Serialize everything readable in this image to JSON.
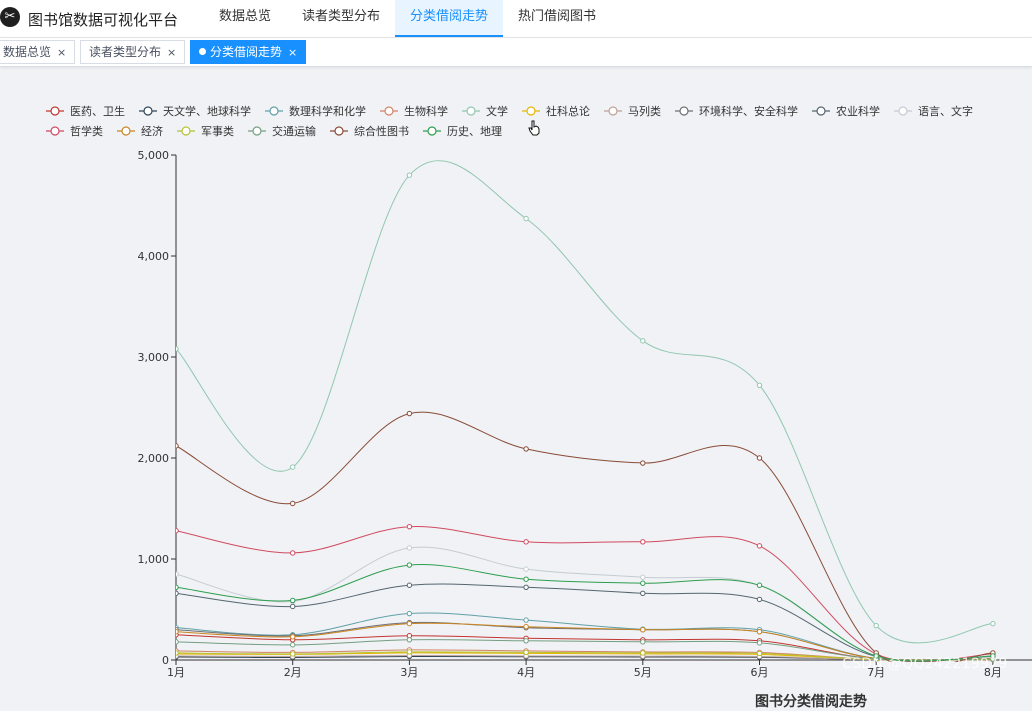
{
  "app": {
    "title": "图书馆数据可视化平台",
    "logo_icon": "scissors-logo-icon"
  },
  "nav": [
    {
      "label": "数据总览",
      "active": false
    },
    {
      "label": "读者类型分布",
      "active": false
    },
    {
      "label": "分类借阅走势",
      "active": true
    },
    {
      "label": "热门借阅图书",
      "active": false
    }
  ],
  "tags": [
    {
      "label": "数据总览",
      "active": false
    },
    {
      "label": "读者类型分布",
      "active": false
    },
    {
      "label": "分类借阅走势",
      "active": true
    }
  ],
  "tag_close_symbol": "×",
  "watermark": "CSDN @QQ242219979",
  "chart_data": {
    "type": "line",
    "title": "图书分类借阅走势",
    "x": [
      "1月",
      "2月",
      "3月",
      "4月",
      "5月",
      "6月",
      "7月",
      "8月"
    ],
    "ylim": [
      0,
      5000
    ],
    "yticks": [
      "0",
      "1,000",
      "2,000",
      "3,000",
      "4,000",
      "5,000"
    ],
    "grid": false,
    "smooth": true,
    "legend_position": "top",
    "series": [
      {
        "name": "医药、卫生",
        "color": "#c23531",
        "values": [
          250,
          200,
          240,
          215,
          200,
          190,
          10,
          10
        ]
      },
      {
        "name": "天文学、地球科学",
        "color": "#2f4554",
        "values": [
          30,
          25,
          35,
          32,
          30,
          28,
          5,
          5
        ]
      },
      {
        "name": "数理科学和化学",
        "color": "#61a0a8",
        "values": [
          320,
          250,
          460,
          395,
          305,
          300,
          15,
          15
        ]
      },
      {
        "name": "生物科学",
        "color": "#d48265",
        "values": [
          90,
          75,
          100,
          90,
          80,
          75,
          5,
          5
        ]
      },
      {
        "name": "文学",
        "color": "#91c7ae",
        "values": [
          3080,
          1910,
          4800,
          4370,
          3160,
          2720,
          340,
          360
        ]
      },
      {
        "name": "社科总论",
        "color": "#e6b600",
        "values": [
          60,
          55,
          70,
          65,
          60,
          55,
          5,
          5
        ]
      },
      {
        "name": "马列类",
        "color": "#bda29a",
        "values": [
          40,
          35,
          45,
          40,
          38,
          35,
          3,
          3
        ]
      },
      {
        "name": "环境科学、安全科学",
        "color": "#6e7074",
        "values": [
          300,
          240,
          370,
          320,
          300,
          280,
          15,
          15
        ]
      },
      {
        "name": "农业科学",
        "color": "#546570",
        "values": [
          660,
          530,
          740,
          720,
          660,
          600,
          35,
          35
        ]
      },
      {
        "name": "语言、文字",
        "color": "#c4ccd3",
        "values": [
          850,
          580,
          1110,
          900,
          820,
          740,
          40,
          40
        ]
      },
      {
        "name": "哲学类",
        "color": "#d14a61",
        "values": [
          1280,
          1060,
          1320,
          1170,
          1170,
          1130,
          60,
          60
        ]
      },
      {
        "name": "经济",
        "color": "#ca8622",
        "values": [
          280,
          230,
          360,
          330,
          300,
          280,
          15,
          15
        ]
      },
      {
        "name": "军事类",
        "color": "#b5c334",
        "values": [
          70,
          60,
          80,
          75,
          70,
          65,
          5,
          5
        ]
      },
      {
        "name": "交通运输",
        "color": "#749f83",
        "values": [
          180,
          150,
          200,
          190,
          180,
          170,
          10,
          10
        ]
      },
      {
        "name": "综合性图书",
        "color": "#8a4b38",
        "values": [
          2120,
          1550,
          2440,
          2090,
          1950,
          2000,
          70,
          70
        ]
      },
      {
        "name": "历史、地理",
        "color": "#2e9e4f",
        "values": [
          720,
          590,
          940,
          800,
          760,
          740,
          40,
          40
        ]
      }
    ]
  }
}
